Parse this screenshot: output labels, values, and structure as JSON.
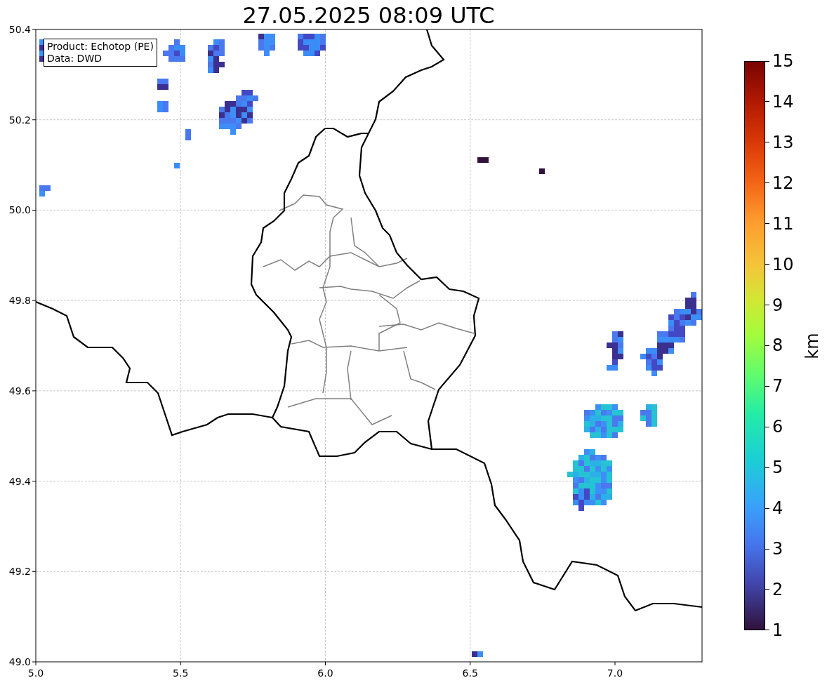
{
  "title": "27.05.2025 08:09 UTC",
  "info_box": {
    "lines": [
      "Product: Echotop (PE)",
      "Data: DWD"
    ]
  },
  "x_ticks": [
    "5.0",
    "5.5",
    "6.0",
    "6.5",
    "7.0"
  ],
  "y_ticks": [
    "50.4",
    "50.2",
    "50.0",
    "49.8",
    "49.6",
    "49.4",
    "49.2",
    "49.0"
  ],
  "colorbar": {
    "label": "km",
    "ticks": [
      "15",
      "14",
      "13",
      "12",
      "11",
      "10",
      "9",
      "8",
      "7",
      "6",
      "5",
      "4",
      "3",
      "2",
      "1"
    ]
  }
}
